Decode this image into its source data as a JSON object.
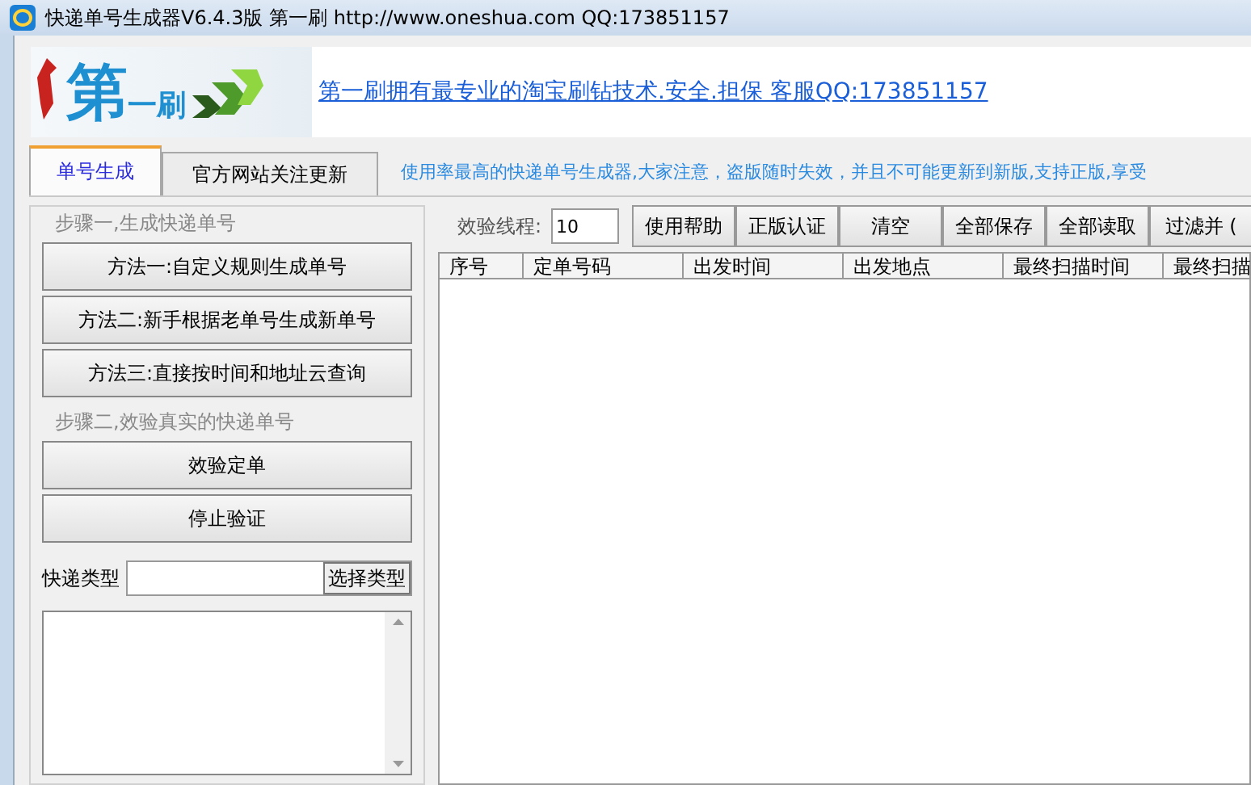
{
  "window": {
    "title": "快递单号生成器V6.4.3版 第一刷 http://www.oneshua.com QQ:173851157"
  },
  "banner": {
    "logo": [
      "第",
      "一刷"
    ],
    "link": "第一刷拥有最专业的淘宝刷钻技术.安全.担保 客服QQ:173851157"
  },
  "tabs": [
    {
      "label": "单号生成",
      "selected": true
    },
    {
      "label": "官方网站关注更新",
      "selected": false
    }
  ],
  "notice": "使用率最高的快递单号生成器,大家注意，盗版随时失效，并且不可能更新到新版,支持正版,享受",
  "left": {
    "step1": "步骤一,生成快递单号",
    "methods": [
      "方法一:自定义规则生成单号",
      "方法二:新手根据老单号生成新单号",
      "方法三:直接按时间和地址云查询"
    ],
    "step2": "步骤二,效验真实的快递单号",
    "verify_buttons": [
      "效验定单",
      "停止验证"
    ],
    "type_label": "快递类型",
    "type_button": "选择类型"
  },
  "toolbar": {
    "thread_label": "效验线程:",
    "thread_value": "10",
    "buttons": [
      "使用帮助",
      "正版认证",
      "清空",
      "全部保存",
      "全部读取",
      "过滤并 ("
    ]
  },
  "table": {
    "columns": [
      "序号",
      "定单号码",
      "出发时间",
      "出发地点",
      "最终扫描时间",
      "最终扫描"
    ]
  }
}
